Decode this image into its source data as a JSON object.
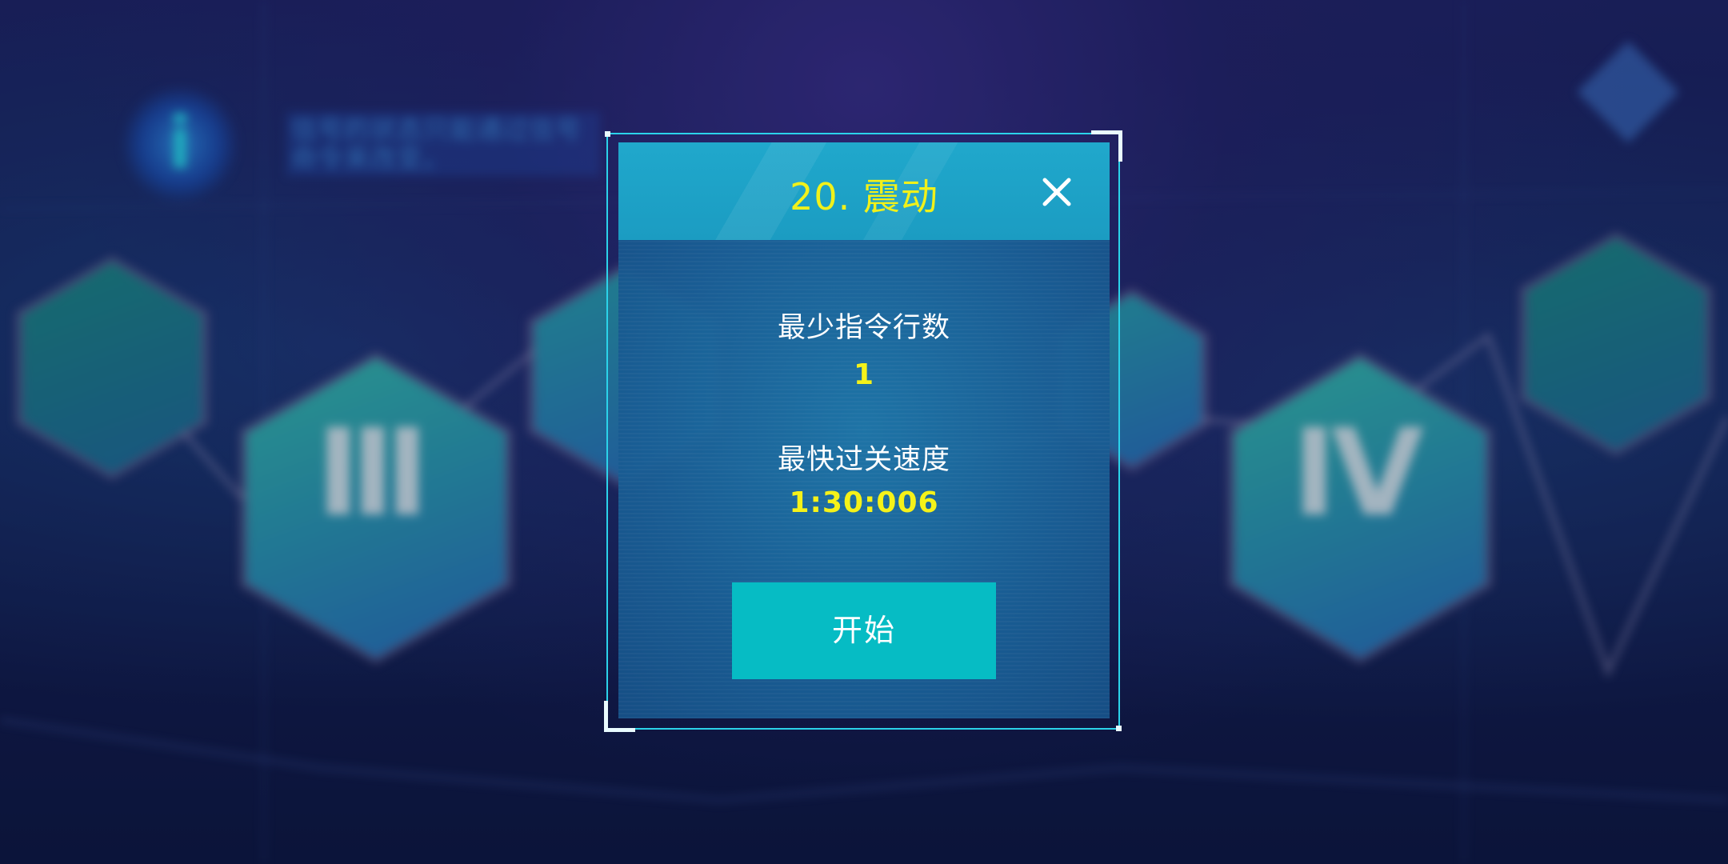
{
  "background": {
    "hint_text": "信号的状态只能通过信号命令来改变。",
    "info_icon": "info-icon",
    "hex_glyphs": [
      "Ⅲ",
      "Ⅳ"
    ]
  },
  "dialog": {
    "title": "20. 震动",
    "close_icon": "close-icon",
    "min_lines_label": "最少指令行数",
    "min_lines_value": "1",
    "fastest_label": "最快过关速度",
    "fastest_value": "1:30:006",
    "start_label": "开始"
  },
  "colors": {
    "accent_yellow": "#f5f219",
    "frame_cyan": "#2bd3ea",
    "button_teal": "#06bcc4",
    "header_blue": "#1b9cc2"
  }
}
